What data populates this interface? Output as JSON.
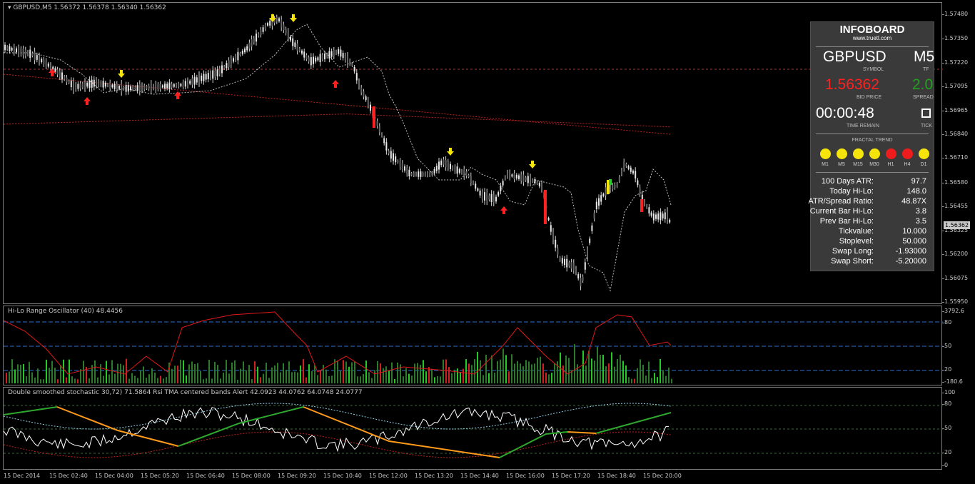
{
  "main": {
    "title": "GBPUSD,M5  1.56372 1.56378 1.56340 1.56362",
    "price_axis": [
      "1.57480",
      "1.57350",
      "1.57220",
      "1.57095",
      "1.56965",
      "1.56840",
      "1.56710",
      "1.56580",
      "1.56455",
      "1.56325",
      "1.56200",
      "1.56075",
      "1.55950"
    ],
    "current_price_tag": "1.56362"
  },
  "oscillator": {
    "title": "Hi-Lo Range Oscillator (40) 48.4456",
    "axis": [
      "3792.6",
      "80",
      "50",
      "20",
      "-180.6"
    ]
  },
  "stochastic": {
    "title": "Double smoothed stochastic 30,72) 71.5864  Rsi TMA centered bands Alert 42.0923 44.0762 64.0748 24.0777",
    "axis": [
      "100",
      "80",
      "50",
      "20",
      "0"
    ]
  },
  "time_axis": [
    "15 Dec 2014",
    "15 Dec 02:40",
    "15 Dec 04:00",
    "15 Dec 05:20",
    "15 Dec 06:40",
    "15 Dec 08:00",
    "15 Dec 09:20",
    "15 Dec 10:40",
    "15 Dec 12:00",
    "15 Dec 13:20",
    "15 Dec 14:40",
    "15 Dec 16:00",
    "15 Dec 17:20",
    "15 Dec 18:40",
    "15 Dec 20:00"
  ],
  "infoboard": {
    "title": "INFOBOARD",
    "url": "www.truetl.com",
    "symbol": "GBPUSD",
    "symbol_label": "SYMBOL",
    "tf": "M5",
    "tf_label": "TF",
    "bid": "1.56362",
    "bid_label": "BID PRICE",
    "spread": "2.0",
    "spread_label": "SPREAD",
    "time_remain": "00:00:48",
    "time_remain_label": "TIME REMAIN",
    "tick_label": "TICK",
    "fractal_title": "FRACTAL TREND",
    "fractal": [
      {
        "tf": "M1",
        "color": "#f5e50a"
      },
      {
        "tf": "M5",
        "color": "#f5e50a"
      },
      {
        "tf": "M15",
        "color": "#f5e50a"
      },
      {
        "tf": "M30",
        "color": "#f5e50a"
      },
      {
        "tf": "H1",
        "color": "#ee1c1c"
      },
      {
        "tf": "H4",
        "color": "#ee1c1c"
      },
      {
        "tf": "D1",
        "color": "#f5e50a"
      }
    ],
    "stats": [
      {
        "label": "100 Days ATR:",
        "value": "97.7"
      },
      {
        "label": "Today Hi-Lo:",
        "value": "148.0"
      },
      {
        "label": "ATR/Spread Ratio:",
        "value": "48.87X"
      },
      {
        "label": "Current Bar Hi-Lo:",
        "value": "3.8"
      },
      {
        "label": "Prev Bar Hi-Lo:",
        "value": "3.5"
      },
      {
        "label": "Tickvalue:",
        "value": "10.000"
      },
      {
        "label": "Stoplevel:",
        "value": "50.000"
      },
      {
        "label": "Swap Long:",
        "value": "-1.93000"
      },
      {
        "label": "Swap Short:",
        "value": "-5.20000"
      }
    ],
    "colors": {
      "bid": "#ff2020",
      "spread": "#1fa31f"
    }
  }
}
